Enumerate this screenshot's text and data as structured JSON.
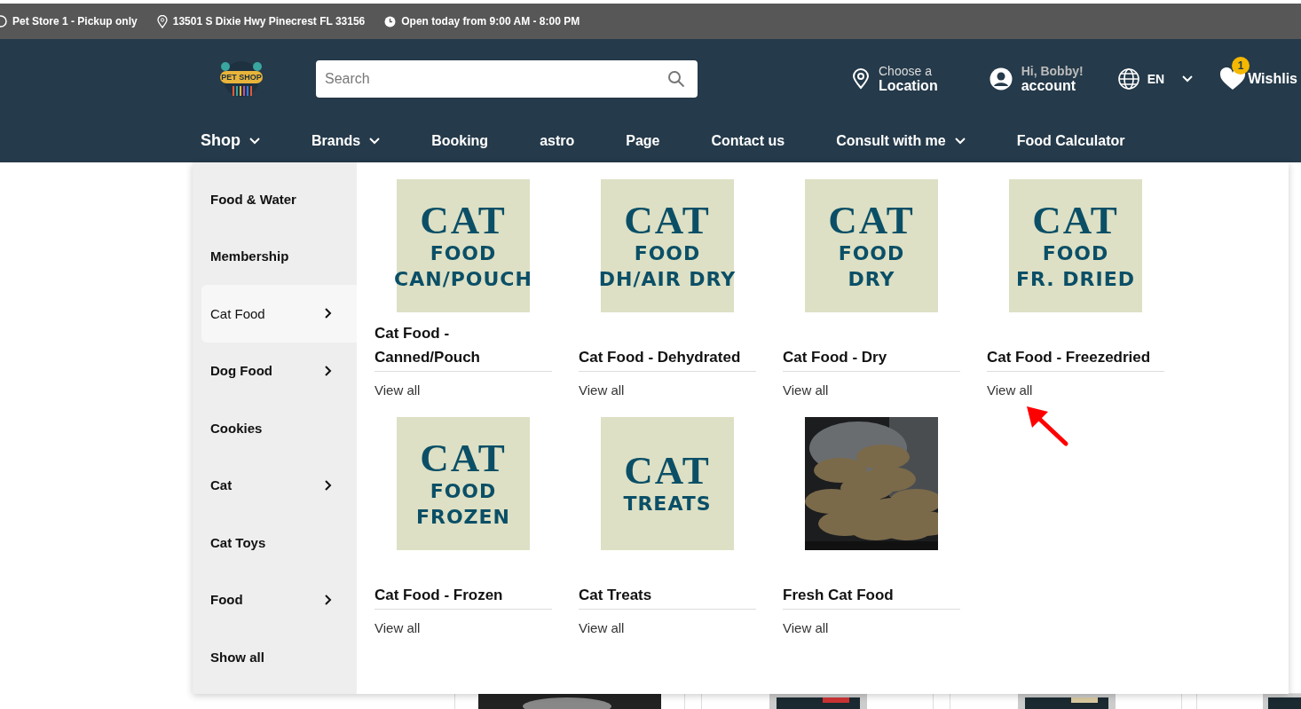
{
  "top_bar": [
    {
      "kind": "store",
      "text": "Pet Store 1 - Pickup only"
    },
    {
      "kind": "pin",
      "text": "13501 S Dixie Hwy Pinecrest FL 33156"
    },
    {
      "kind": "clock",
      "text": "Open today from 9:00 AM - 8:00 PM"
    }
  ],
  "header": {
    "logo_text": "PET SHOP",
    "search": {
      "placeholder": "Search"
    },
    "location": {
      "line1": "Choose a",
      "line2": "Location"
    },
    "account": {
      "line1": "Hi, Bobby!",
      "line2": "account"
    },
    "language": "EN",
    "wishlist": {
      "label": "Wishlis",
      "count": "1"
    }
  },
  "nav": [
    {
      "label": "Shop",
      "dropdown": true,
      "selected": true
    },
    {
      "label": "Brands",
      "dropdown": true,
      "selected": false
    },
    {
      "label": "Booking",
      "dropdown": false,
      "selected": false
    },
    {
      "label": "astro",
      "dropdown": false,
      "selected": false
    },
    {
      "label": "Page",
      "dropdown": false,
      "selected": false
    },
    {
      "label": "Contact us",
      "dropdown": false,
      "selected": false
    },
    {
      "label": "Consult with me",
      "dropdown": true,
      "selected": false
    },
    {
      "label": "Food Calculator",
      "dropdown": false,
      "selected": false
    }
  ],
  "menu": {
    "categories": [
      {
        "label": "Food & Water",
        "has_children": false,
        "selected": false
      },
      {
        "label": "Membership",
        "has_children": false,
        "selected": false
      },
      {
        "label": "Cat Food",
        "has_children": true,
        "selected": true
      },
      {
        "label": "Dog Food",
        "has_children": true,
        "selected": false
      },
      {
        "label": "Cookies",
        "has_children": false,
        "selected": false
      },
      {
        "label": "Cat",
        "has_children": true,
        "selected": false
      },
      {
        "label": "Cat Toys",
        "has_children": false,
        "selected": false
      },
      {
        "label": "Food",
        "has_children": true,
        "selected": false
      },
      {
        "label": "Show all",
        "has_children": false,
        "selected": false
      }
    ],
    "subcategories": [
      {
        "title": "Cat Food - Canned/Pouch",
        "link": "View all",
        "tile": [
          {
            "text": "CAT",
            "kind": "serif"
          },
          {
            "text": "FOOD",
            "kind": "sans"
          },
          {
            "text": "CAN/POUCH",
            "kind": "sans"
          }
        ]
      },
      {
        "title": "Cat Food - Dehydrated",
        "link": "View all",
        "tile": [
          {
            "text": "CAT",
            "kind": "serif"
          },
          {
            "text": "FOOD",
            "kind": "sans"
          },
          {
            "text": "DH/AIR DRY",
            "kind": "sans"
          }
        ]
      },
      {
        "title": "Cat Food - Dry",
        "link": "View all",
        "tile": [
          {
            "text": "CAT",
            "kind": "serif"
          },
          {
            "text": "FOOD",
            "kind": "sans"
          },
          {
            "text": "DRY",
            "kind": "sans"
          }
        ]
      },
      {
        "title": "Cat Food - Freezedried",
        "link": "View all",
        "tile": [
          {
            "text": "CAT",
            "kind": "serif"
          },
          {
            "text": "FOOD",
            "kind": "sans"
          },
          {
            "text": "FR. DRIED",
            "kind": "sans"
          }
        ]
      },
      {
        "title": "Cat Food - Frozen",
        "link": "View all",
        "tile": [
          {
            "text": "CAT",
            "kind": "serif"
          },
          {
            "text": "FOOD",
            "kind": "sans"
          },
          {
            "text": "FROZEN",
            "kind": "sans"
          }
        ]
      },
      {
        "title": "Cat Treats",
        "link": "View all",
        "tile": [
          {
            "text": "CAT",
            "kind": "serif"
          },
          {
            "text": "TREATS",
            "kind": "sans"
          }
        ]
      },
      {
        "title": "Fresh Cat Food",
        "link": "View all",
        "kind": "picture"
      }
    ]
  }
}
